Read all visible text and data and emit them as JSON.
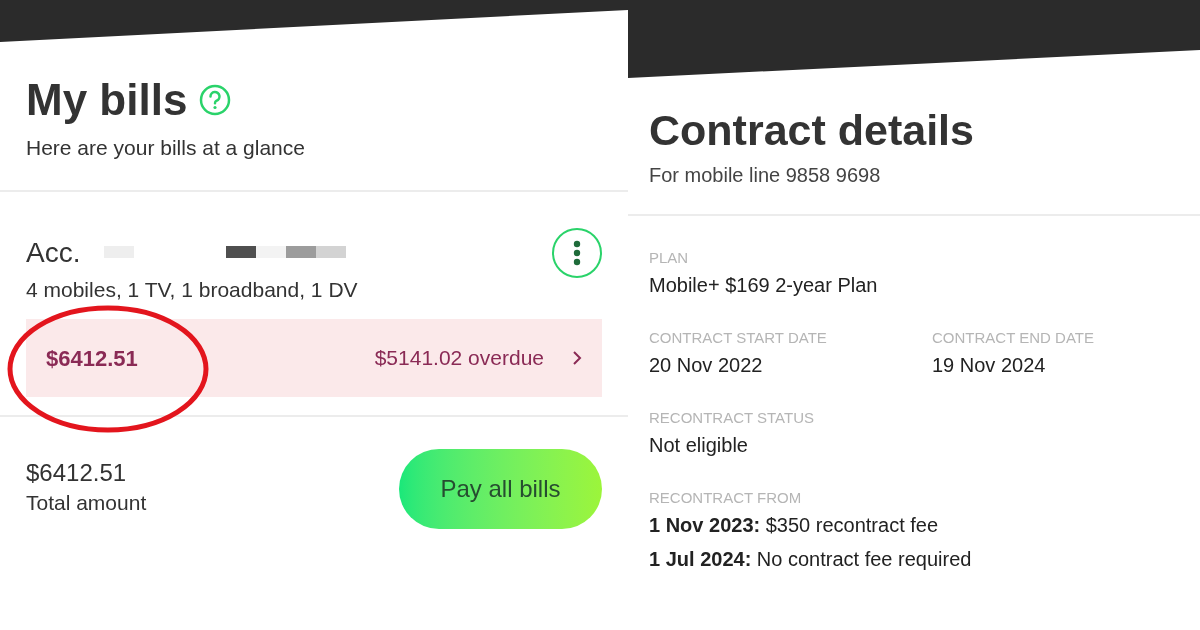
{
  "bills": {
    "title": "My bills",
    "subtitle": "Here are your bills at a glance",
    "account": {
      "label": "Acc.",
      "summary": "4 mobiles, 1 TV, 1 broadband, 1 DV",
      "amount": "$6412.51",
      "overdue": "$5141.02 overdue",
      "circled": true
    },
    "total": {
      "amount": "$6412.51",
      "label": "Total amount"
    },
    "pay_button": "Pay all bills"
  },
  "contract": {
    "title": "Contract details",
    "subtitle": "For mobile line 9858 9698",
    "sections": [
      [
        {
          "label": "PLAN",
          "lines": [
            "Mobile+ $169 2-year Plan"
          ]
        }
      ],
      [
        {
          "label": "CONTRACT START DATE",
          "lines": [
            "20 Nov 2022"
          ]
        },
        {
          "label": "CONTRACT END DATE",
          "lines": [
            "19 Nov 2024"
          ]
        }
      ],
      [
        {
          "label": "RECONTRACT STATUS",
          "lines": [
            "Not eligible"
          ]
        }
      ],
      [
        {
          "label": "RECONTRACT FROM",
          "lines": [
            "**1 Nov 2023:** $350 recontract fee",
            "**1 Jul 2024:** No contract fee required"
          ]
        }
      ]
    ]
  }
}
